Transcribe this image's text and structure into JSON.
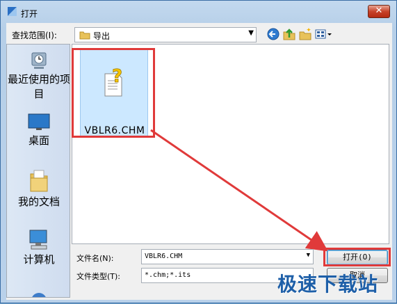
{
  "window": {
    "title": "打开",
    "close_glyph": "✕"
  },
  "toolbar": {
    "look_in_label": "查找范围(I):",
    "look_in_value": "导出",
    "icons": [
      "back-icon",
      "up-folder-icon",
      "new-folder-icon",
      "views-menu-icon"
    ]
  },
  "places": [
    {
      "label": "最近使用的项目",
      "icon": "recent-items-icon"
    },
    {
      "label": "桌面",
      "icon": "desktop-icon"
    },
    {
      "label": "我的文档",
      "icon": "documents-icon"
    },
    {
      "label": "计算机",
      "icon": "computer-icon"
    }
  ],
  "files": [
    {
      "name": "VBLR6.CHM",
      "icon": "chm-help-file-icon",
      "selected": true
    }
  ],
  "form": {
    "filename_label": "文件名(N):",
    "filename_value": "VBLR6.CHM",
    "filetype_label": "文件类型(T):",
    "filetype_value": "*.chm;*.its",
    "open_button": "打开(O)",
    "cancel_button": "取消"
  },
  "watermark": "极速下载站",
  "colors": {
    "highlight": "#e03a3a",
    "selection": "#cce8ff",
    "accent": "#1e5fa8"
  }
}
